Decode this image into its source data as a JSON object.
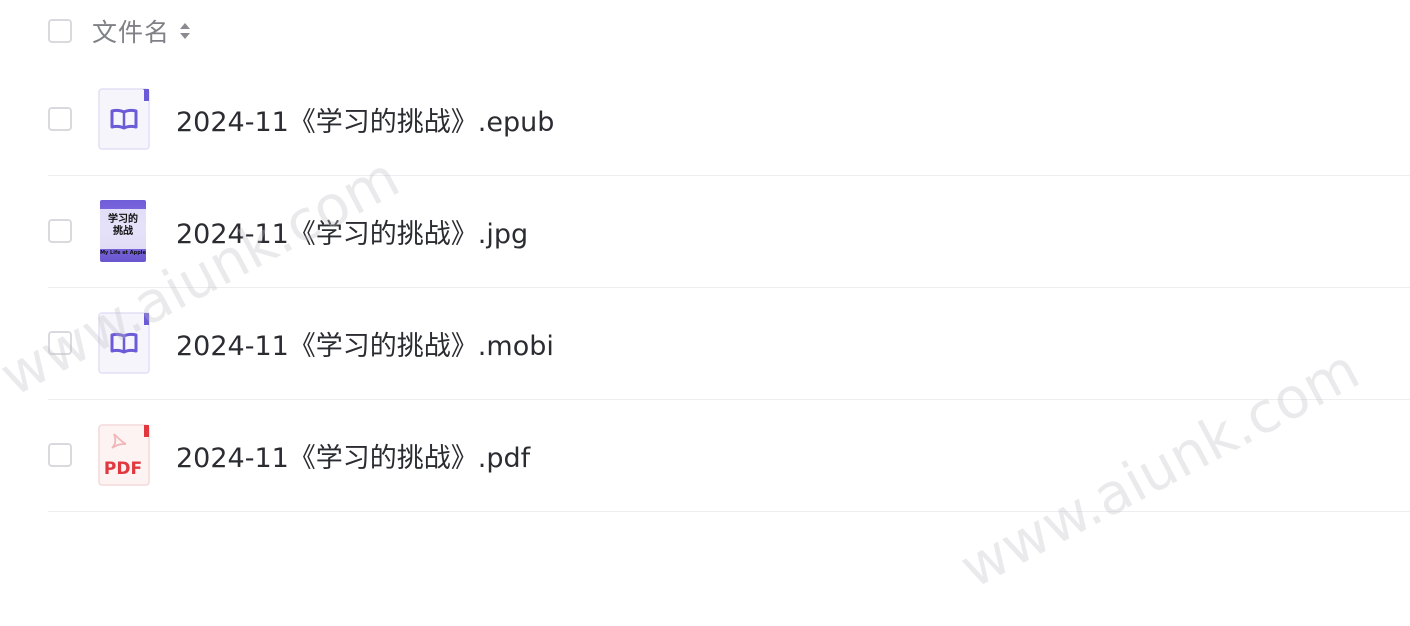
{
  "header": {
    "name_column_label": "文件名"
  },
  "files": [
    {
      "name": "2024-11《学习的挑战》.epub",
      "icon": "ebook-icon"
    },
    {
      "name": "2024-11《学习的挑战》.jpg",
      "icon": "image-thumbnail",
      "cover_title": "学习的\n挑战",
      "cover_subtitle": "My Life at Apple"
    },
    {
      "name": "2024-11《学习的挑战》.mobi",
      "icon": "ebook-icon"
    },
    {
      "name": "2024-11《学习的挑战》.pdf",
      "icon": "pdf-icon",
      "pdf_label": "PDF"
    }
  ],
  "watermarks": [
    "www.aiunk.com",
    "www.aiunk.com"
  ],
  "colors": {
    "ebook_accent": "#6b5bd6",
    "pdf_accent": "#e0383e",
    "divider": "#eeeef1"
  }
}
